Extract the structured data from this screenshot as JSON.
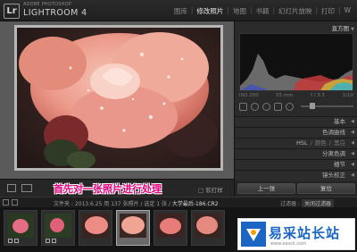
{
  "app": {
    "logo_letters": "Lr",
    "brand_small": "ADOBE PHOTOSHOP",
    "brand_name": "LIGHTROOM 4"
  },
  "modules": [
    {
      "label": "图库",
      "active": false
    },
    {
      "label": "修改照片",
      "active": true
    },
    {
      "label": "地图",
      "active": false
    },
    {
      "label": "书籍",
      "active": false
    },
    {
      "label": "幻灯片放映",
      "active": false
    },
    {
      "label": "打印",
      "active": false
    },
    {
      "label": "W",
      "active": false
    }
  ],
  "right_panel": {
    "histogram_title": "直方图",
    "hist_info": [
      "ISO 200",
      "55 mm",
      "f / 3.5",
      "1/10"
    ],
    "sections": [
      "基本",
      "色调曲线"
    ],
    "hsl": {
      "a": "HSL",
      "b": "颜色",
      "c": "黑白"
    },
    "sections2": [
      "分离色调",
      "细节",
      "镜头校正"
    ],
    "buttons": {
      "previous": "上一张",
      "reset": "复位"
    }
  },
  "toolbar": {
    "caption": "首先对一张照片进行处理",
    "softproof": "□ 软打样"
  },
  "filmstrip_bar": {
    "source": "文件夹 : 2013.6.25 用",
    "count": "137 张照片 / 选定 1 张 /",
    "filename": "大学最后-186.CR2",
    "filter_label": "过滤器 :",
    "filter_value": "关闭过滤器"
  },
  "watermark": {
    "text": "易采站长站",
    "url": "www.easck.com"
  },
  "colors": {
    "caption": "#e3007f",
    "watermark_blue": "#1a66c2"
  }
}
